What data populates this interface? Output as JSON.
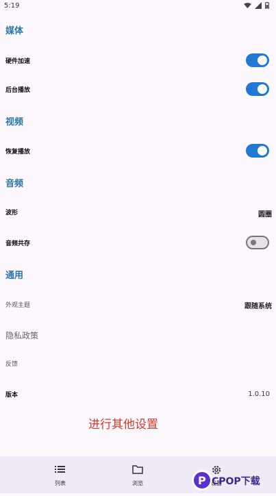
{
  "status_bar": {
    "time": "5:19"
  },
  "sections": {
    "media": {
      "header": "媒体",
      "hardware_accel": {
        "label": "硬件加速",
        "enabled": true
      },
      "background_play": {
        "label": "后台播放",
        "enabled": true
      }
    },
    "video": {
      "header": "视频",
      "resume_play": {
        "label": "恢复播放",
        "enabled": true
      }
    },
    "audio": {
      "header": "音频",
      "waveform": {
        "label": "波形",
        "value": "圆圈"
      },
      "audio_share": {
        "label": "音频共存",
        "enabled": false
      }
    },
    "general": {
      "header": "通用",
      "theme": {
        "label": "外观主题",
        "value": "跟随系统"
      },
      "privacy": {
        "label": "隐私政策"
      },
      "feedback": {
        "label": "反馈"
      },
      "version": {
        "label": "版本",
        "value": "1.0.10"
      }
    }
  },
  "promo_text": "进行其他设置",
  "bottom_nav": {
    "items": [
      {
        "label": "列表",
        "icon": "list-icon"
      },
      {
        "label": "浏览",
        "icon": "folder-icon"
      },
      {
        "label": "设置",
        "icon": "gear-icon"
      }
    ]
  },
  "watermark": {
    "text": "PCPOP下载"
  },
  "colors": {
    "accent": "#2b77a8",
    "toggle_on": "#1e78d4",
    "promo": "#d9382b",
    "background": "#fdf8fd",
    "nav_background": "#f0e9f6"
  }
}
